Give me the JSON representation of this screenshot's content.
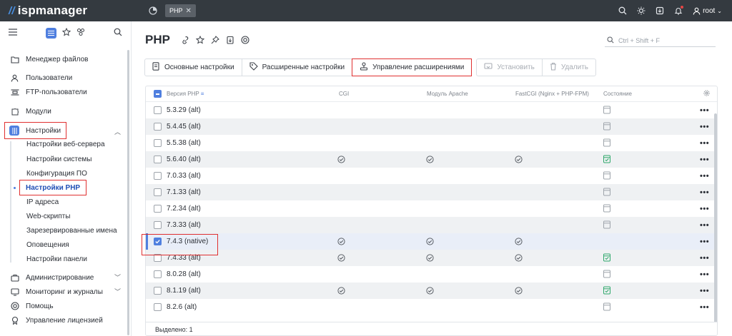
{
  "app": {
    "logo": "ispmanager"
  },
  "topbar": {
    "tab_label": "PHP",
    "tab_close": "✕",
    "user": "root"
  },
  "sidebar": {
    "items": [
      {
        "label": "Менеджер файлов"
      },
      {
        "label": "Пользователи"
      },
      {
        "label": "FTP-пользователи"
      },
      {
        "label": "Модули"
      },
      {
        "label": "Настройки"
      },
      {
        "label": "Администрирование"
      },
      {
        "label": "Мониторинг и журналы"
      },
      {
        "label": "Помощь"
      },
      {
        "label": "Управление лицензией"
      }
    ],
    "sub_items": [
      {
        "label": "Настройки веб-сервера"
      },
      {
        "label": "Настройки системы"
      },
      {
        "label": "Конфигурация ПО"
      },
      {
        "label": "Настройки PHP"
      },
      {
        "label": "IP адреса"
      },
      {
        "label": "Web-скрипты"
      },
      {
        "label": "Зарезервированные имена"
      },
      {
        "label": "Оповещения"
      },
      {
        "label": "Настройки панели"
      }
    ]
  },
  "main": {
    "title": "PHP",
    "search_placeholder": "Ctrl + Shift + F",
    "toolbar": {
      "basic": "Основные настройки",
      "advanced": "Расширенные настройки",
      "extensions": "Управление расширениями",
      "install": "Установить",
      "delete": "Удалить"
    },
    "table": {
      "columns": [
        "Версия PHP",
        "CGI",
        "Модуль Apache",
        "FastCGI (Nginx + PHP-FPM)",
        "Состояние"
      ],
      "rows": [
        {
          "version": "5.3.29 (alt)",
          "cgi": false,
          "apache": false,
          "fpm": false,
          "state": "off"
        },
        {
          "version": "5.4.45 (alt)",
          "cgi": false,
          "apache": false,
          "fpm": false,
          "state": "off"
        },
        {
          "version": "5.5.38 (alt)",
          "cgi": false,
          "apache": false,
          "fpm": false,
          "state": "off"
        },
        {
          "version": "5.6.40 (alt)",
          "cgi": true,
          "apache": true,
          "fpm": true,
          "state": "on"
        },
        {
          "version": "7.0.33 (alt)",
          "cgi": false,
          "apache": false,
          "fpm": false,
          "state": "off"
        },
        {
          "version": "7.1.33 (alt)",
          "cgi": false,
          "apache": false,
          "fpm": false,
          "state": "off"
        },
        {
          "version": "7.2.34 (alt)",
          "cgi": false,
          "apache": false,
          "fpm": false,
          "state": "off"
        },
        {
          "version": "7.3.33 (alt)",
          "cgi": false,
          "apache": false,
          "fpm": false,
          "state": "off"
        },
        {
          "version": "7.4.3 (native)",
          "cgi": true,
          "apache": true,
          "fpm": true,
          "state": "none"
        },
        {
          "version": "7.4.33 (alt)",
          "cgi": true,
          "apache": true,
          "fpm": true,
          "state": "on"
        },
        {
          "version": "8.0.28 (alt)",
          "cgi": false,
          "apache": false,
          "fpm": false,
          "state": "off"
        },
        {
          "version": "8.1.19 (alt)",
          "cgi": true,
          "apache": true,
          "fpm": true,
          "state": "on"
        },
        {
          "version": "8.2.6 (alt)",
          "cgi": false,
          "apache": false,
          "fpm": false,
          "state": "off"
        }
      ],
      "selected_index": 8,
      "footer": "Выделено: 1"
    }
  },
  "colors": {
    "accent": "#4f7fdf",
    "topbar": "#343a40",
    "highlight": "#e03030",
    "state_on": "#2fa86b"
  }
}
